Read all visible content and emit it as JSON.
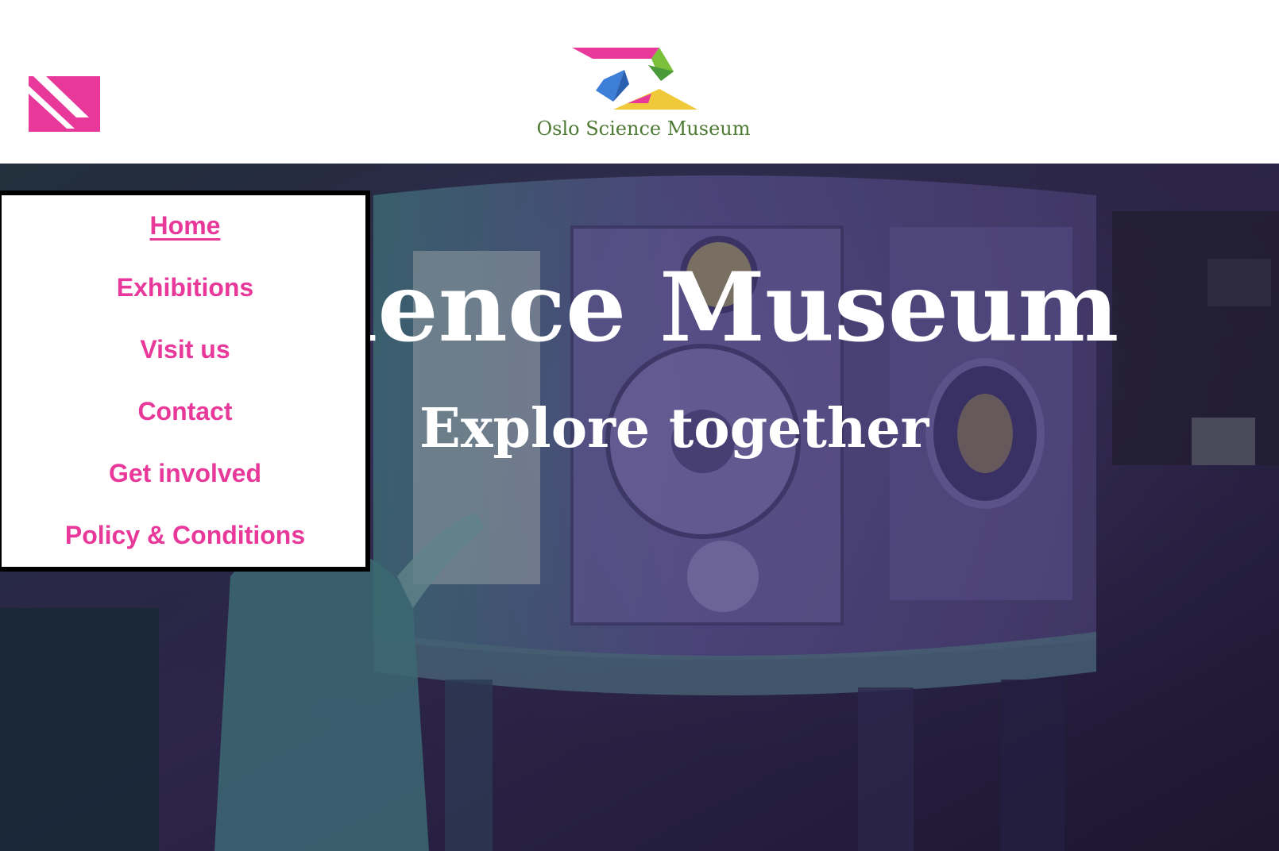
{
  "header": {
    "menu_icon": "menu-toggle-icon",
    "logo_text": "Oslo Science Museum"
  },
  "hero": {
    "title": "Science Museum",
    "subtitle": "Explore together"
  },
  "nav": {
    "items": [
      {
        "label": "Home",
        "active": true
      },
      {
        "label": "Exhibitions",
        "active": false
      },
      {
        "label": "Visit us",
        "active": false
      },
      {
        "label": "Contact",
        "active": false
      },
      {
        "label": "Get involved",
        "active": false
      },
      {
        "label": "Policy & Conditions",
        "active": false
      }
    ]
  },
  "colors": {
    "accent": "#e8399b",
    "logo_green": "#4e7a34",
    "logo_blue": "#3d7ed8",
    "logo_yellow": "#f0c93a",
    "logo_lime": "#7bbf3a"
  }
}
